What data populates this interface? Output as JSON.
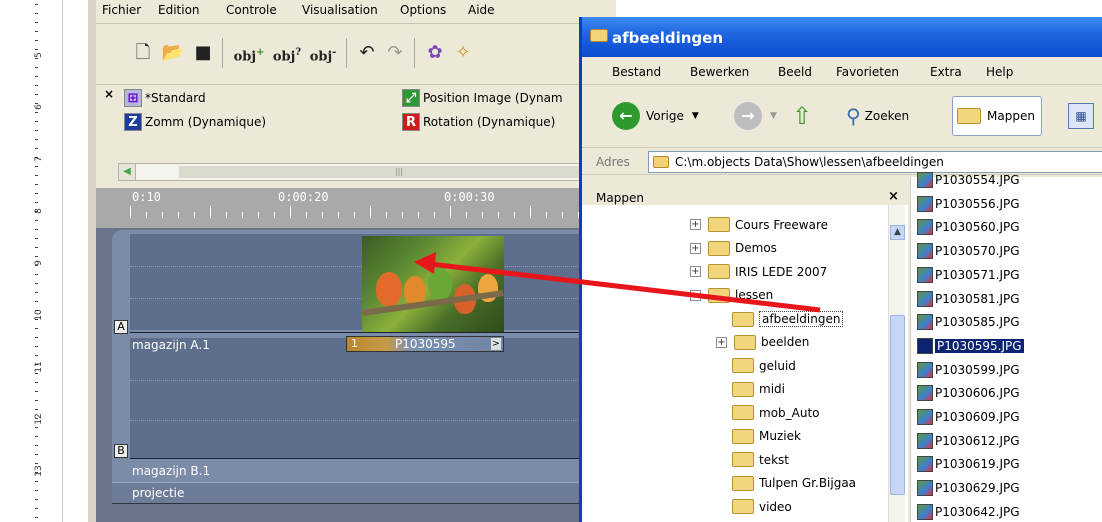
{
  "app": {
    "menu": [
      "Fichier",
      "Edition",
      "Controle",
      "Visualisation",
      "Options",
      "Aide"
    ],
    "effects": {
      "standard": "*Standard",
      "zoom": "Zomm (Dynamique)",
      "position": "Position Image (Dynam",
      "rotation": "Rotation (Dynamique)"
    },
    "timeline": {
      "labels": [
        "0:10",
        "0:00:20",
        "0:00:30"
      ],
      "track_a_letter": "A",
      "track_a_name": "magazijn A.1",
      "track_b_letter": "B",
      "track_b_name": "magazijn B.1",
      "projectie": "projectie",
      "clip_label": "P1030595",
      "clip_number": "1"
    }
  },
  "ruler": {
    "numbers": [
      "5",
      "6",
      "7",
      "8",
      "9",
      "10",
      "11",
      "12",
      "13"
    ]
  },
  "explorer": {
    "title": "afbeeldingen",
    "menu": [
      "Bestand",
      "Bewerken",
      "Beeld",
      "Favorieten",
      "Extra",
      "Help"
    ],
    "toolbar": {
      "back": "Vorige",
      "search": "Zoeken",
      "folders": "Mappen"
    },
    "address_label": "Adres",
    "address_value": "C:\\m.objects Data\\Show\\lessen\\afbeeldingen",
    "folders_title": "Mappen",
    "tree": [
      {
        "label": "Cours Freeware",
        "expander": "+"
      },
      {
        "label": "Demos",
        "expander": "+"
      },
      {
        "label": "IRIS LEDE 2007",
        "expander": "+"
      },
      {
        "label": "lessen",
        "expander": "-"
      },
      {
        "label": "afbeeldingen",
        "expander": ""
      },
      {
        "label": "beelden",
        "expander": "+"
      },
      {
        "label": "geluid",
        "expander": ""
      },
      {
        "label": "midi",
        "expander": ""
      },
      {
        "label": "mob_Auto",
        "expander": ""
      },
      {
        "label": "Muziek",
        "expander": ""
      },
      {
        "label": "tekst",
        "expander": ""
      },
      {
        "label": "Tulpen Gr.Bijgaa",
        "expander": ""
      },
      {
        "label": "video",
        "expander": ""
      }
    ],
    "files": [
      "P1030554.JPG",
      "P1030556.JPG",
      "P1030560.JPG",
      "P1030570.JPG",
      "P1030571.JPG",
      "P1030581.JPG",
      "P1030585.JPG",
      "P1030595.JPG",
      "P1030599.JPG",
      "P1030606.JPG",
      "P1030609.JPG",
      "P1030612.JPG",
      "P1030619.JPG",
      "P1030629.JPG",
      "P1030642.JPG"
    ],
    "selected_file": "P1030595.JPG"
  },
  "colors": {
    "arrow": "#e8151b",
    "xp_title": "#0a4cd0",
    "timeline_track": "#5e6f8e"
  }
}
